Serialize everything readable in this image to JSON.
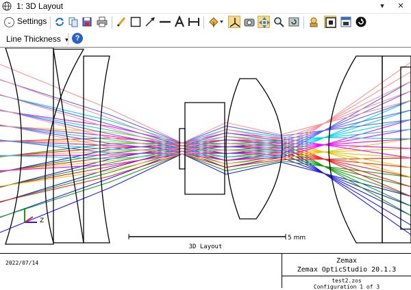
{
  "window": {
    "title": "1: 3D Layout",
    "menu_glyph": "▾",
    "close_glyph": "✕"
  },
  "toolbar": {
    "settings_label": "Settings",
    "settings_glyph": "⌄",
    "buttons": [
      "refresh-icon",
      "copy-icon",
      "save-icon",
      "print-icon",
      "pencil-icon",
      "rectangle-icon",
      "arrow-icon",
      "line-icon",
      "text-icon",
      "dimension-icon",
      "rotate-icon",
      "axes-icon",
      "camera-icon",
      "pan-icon",
      "zoom-icon",
      "reset-view-icon",
      "lock-icon",
      "fit-icon",
      "window-icon",
      "circle-arrow-icon"
    ]
  },
  "toolbar2": {
    "line_thickness_label": "Line Thickness",
    "dropdown_glyph": "▾",
    "help_glyph": "?"
  },
  "plot": {
    "scale_label": "5 mm",
    "caption": "3D Layout",
    "axis_label": "Z",
    "ray_colors": [
      "#1c1cf0",
      "#12a012",
      "#ff2020",
      "#e8c500",
      "#ff00ff",
      "#00d8e8",
      "#6060ff",
      "#ff9090"
    ]
  },
  "footer": {
    "date": "2022/07/14",
    "company": "Zemax",
    "product": "Zemax OpticStudio 20.1.3",
    "file": "test2.zos",
    "config": "Configuration 1 of 3"
  }
}
